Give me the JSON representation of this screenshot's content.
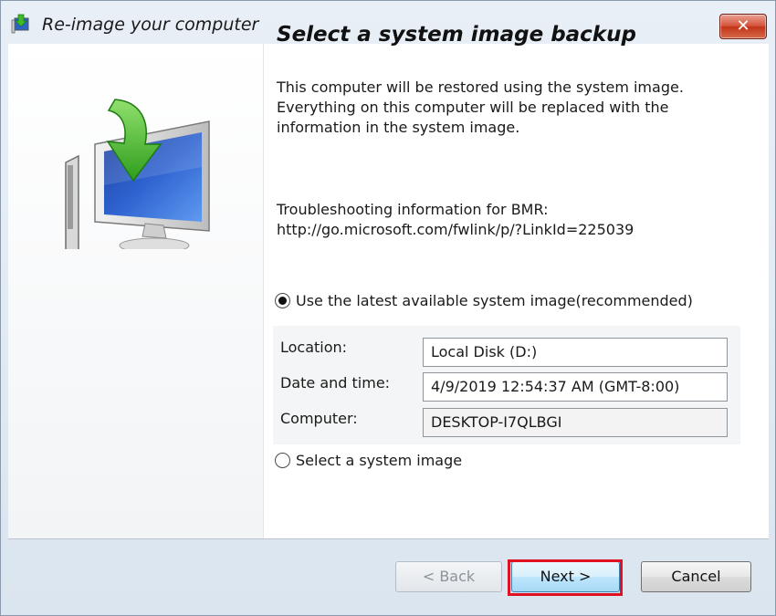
{
  "window": {
    "title": "Re-image your computer",
    "close_label": "✕"
  },
  "content": {
    "heading": "Select a system image backup",
    "description": "This computer will be restored using the system image. Everything on this computer will be replaced with the information in the system image.",
    "troubleshoot_label": "Troubleshooting information for BMR:",
    "troubleshoot_url": "http://go.microsoft.com/fwlink/p/?LinkId=225039"
  },
  "options": {
    "latest": {
      "label": "Use the latest available system image(recommended)",
      "selected": true
    },
    "select": {
      "label": "Select a system image",
      "selected": false
    }
  },
  "details": {
    "location_label": "Location:",
    "location_value": "Local Disk (D:)",
    "datetime_label": "Date and time:",
    "datetime_value": "4/9/2019 12:54:37 AM (GMT-8:00)",
    "computer_label": "Computer:",
    "computer_value": "DESKTOP-I7QLBGI"
  },
  "buttons": {
    "back": "< Back",
    "next": "Next >",
    "cancel": "Cancel"
  },
  "colors": {
    "highlight": "#e01222",
    "accent_arrow": "#3dbb2a"
  }
}
